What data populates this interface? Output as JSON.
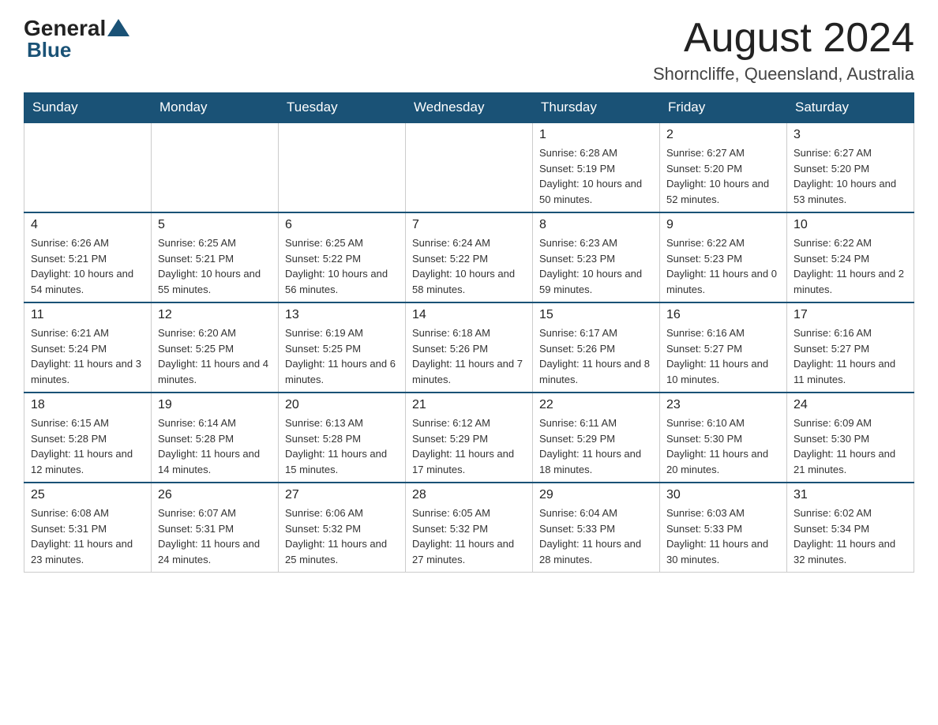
{
  "logo": {
    "text_general": "General",
    "text_blue": "Blue"
  },
  "header": {
    "month": "August 2024",
    "location": "Shorncliffe, Queensland, Australia"
  },
  "weekdays": [
    "Sunday",
    "Monday",
    "Tuesday",
    "Wednesday",
    "Thursday",
    "Friday",
    "Saturday"
  ],
  "weeks": [
    [
      {
        "day": "",
        "info": ""
      },
      {
        "day": "",
        "info": ""
      },
      {
        "day": "",
        "info": ""
      },
      {
        "day": "",
        "info": ""
      },
      {
        "day": "1",
        "info": "Sunrise: 6:28 AM\nSunset: 5:19 PM\nDaylight: 10 hours and 50 minutes."
      },
      {
        "day": "2",
        "info": "Sunrise: 6:27 AM\nSunset: 5:20 PM\nDaylight: 10 hours and 52 minutes."
      },
      {
        "day": "3",
        "info": "Sunrise: 6:27 AM\nSunset: 5:20 PM\nDaylight: 10 hours and 53 minutes."
      }
    ],
    [
      {
        "day": "4",
        "info": "Sunrise: 6:26 AM\nSunset: 5:21 PM\nDaylight: 10 hours and 54 minutes."
      },
      {
        "day": "5",
        "info": "Sunrise: 6:25 AM\nSunset: 5:21 PM\nDaylight: 10 hours and 55 minutes."
      },
      {
        "day": "6",
        "info": "Sunrise: 6:25 AM\nSunset: 5:22 PM\nDaylight: 10 hours and 56 minutes."
      },
      {
        "day": "7",
        "info": "Sunrise: 6:24 AM\nSunset: 5:22 PM\nDaylight: 10 hours and 58 minutes."
      },
      {
        "day": "8",
        "info": "Sunrise: 6:23 AM\nSunset: 5:23 PM\nDaylight: 10 hours and 59 minutes."
      },
      {
        "day": "9",
        "info": "Sunrise: 6:22 AM\nSunset: 5:23 PM\nDaylight: 11 hours and 0 minutes."
      },
      {
        "day": "10",
        "info": "Sunrise: 6:22 AM\nSunset: 5:24 PM\nDaylight: 11 hours and 2 minutes."
      }
    ],
    [
      {
        "day": "11",
        "info": "Sunrise: 6:21 AM\nSunset: 5:24 PM\nDaylight: 11 hours and 3 minutes."
      },
      {
        "day": "12",
        "info": "Sunrise: 6:20 AM\nSunset: 5:25 PM\nDaylight: 11 hours and 4 minutes."
      },
      {
        "day": "13",
        "info": "Sunrise: 6:19 AM\nSunset: 5:25 PM\nDaylight: 11 hours and 6 minutes."
      },
      {
        "day": "14",
        "info": "Sunrise: 6:18 AM\nSunset: 5:26 PM\nDaylight: 11 hours and 7 minutes."
      },
      {
        "day": "15",
        "info": "Sunrise: 6:17 AM\nSunset: 5:26 PM\nDaylight: 11 hours and 8 minutes."
      },
      {
        "day": "16",
        "info": "Sunrise: 6:16 AM\nSunset: 5:27 PM\nDaylight: 11 hours and 10 minutes."
      },
      {
        "day": "17",
        "info": "Sunrise: 6:16 AM\nSunset: 5:27 PM\nDaylight: 11 hours and 11 minutes."
      }
    ],
    [
      {
        "day": "18",
        "info": "Sunrise: 6:15 AM\nSunset: 5:28 PM\nDaylight: 11 hours and 12 minutes."
      },
      {
        "day": "19",
        "info": "Sunrise: 6:14 AM\nSunset: 5:28 PM\nDaylight: 11 hours and 14 minutes."
      },
      {
        "day": "20",
        "info": "Sunrise: 6:13 AM\nSunset: 5:28 PM\nDaylight: 11 hours and 15 minutes."
      },
      {
        "day": "21",
        "info": "Sunrise: 6:12 AM\nSunset: 5:29 PM\nDaylight: 11 hours and 17 minutes."
      },
      {
        "day": "22",
        "info": "Sunrise: 6:11 AM\nSunset: 5:29 PM\nDaylight: 11 hours and 18 minutes."
      },
      {
        "day": "23",
        "info": "Sunrise: 6:10 AM\nSunset: 5:30 PM\nDaylight: 11 hours and 20 minutes."
      },
      {
        "day": "24",
        "info": "Sunrise: 6:09 AM\nSunset: 5:30 PM\nDaylight: 11 hours and 21 minutes."
      }
    ],
    [
      {
        "day": "25",
        "info": "Sunrise: 6:08 AM\nSunset: 5:31 PM\nDaylight: 11 hours and 23 minutes."
      },
      {
        "day": "26",
        "info": "Sunrise: 6:07 AM\nSunset: 5:31 PM\nDaylight: 11 hours and 24 minutes."
      },
      {
        "day": "27",
        "info": "Sunrise: 6:06 AM\nSunset: 5:32 PM\nDaylight: 11 hours and 25 minutes."
      },
      {
        "day": "28",
        "info": "Sunrise: 6:05 AM\nSunset: 5:32 PM\nDaylight: 11 hours and 27 minutes."
      },
      {
        "day": "29",
        "info": "Sunrise: 6:04 AM\nSunset: 5:33 PM\nDaylight: 11 hours and 28 minutes."
      },
      {
        "day": "30",
        "info": "Sunrise: 6:03 AM\nSunset: 5:33 PM\nDaylight: 11 hours and 30 minutes."
      },
      {
        "day": "31",
        "info": "Sunrise: 6:02 AM\nSunset: 5:34 PM\nDaylight: 11 hours and 32 minutes."
      }
    ]
  ]
}
